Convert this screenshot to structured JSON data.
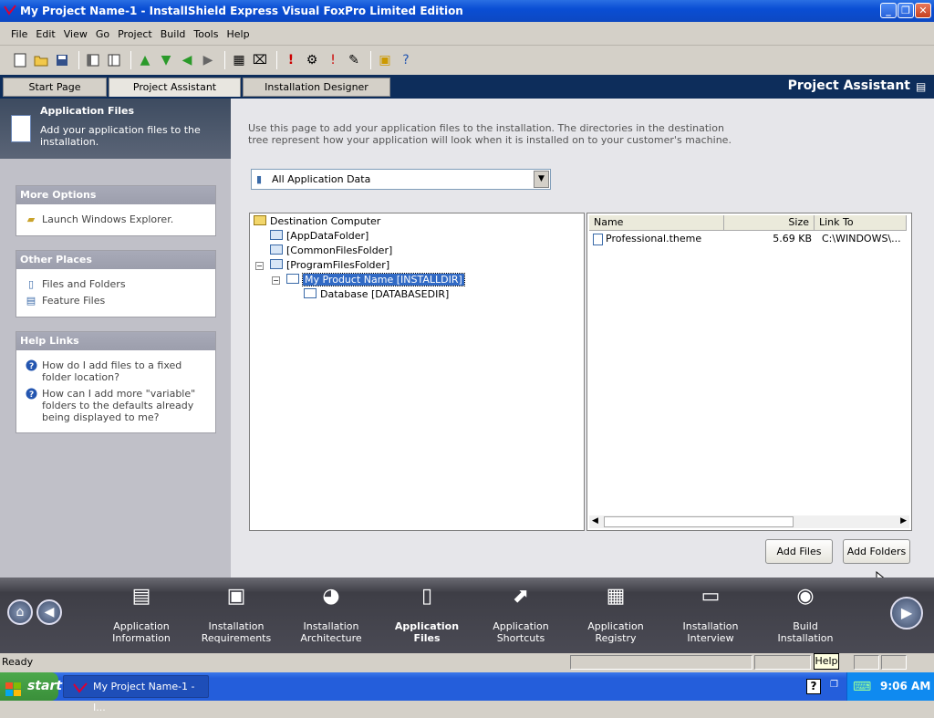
{
  "window": {
    "title": "My Project Name-1 - InstallShield Express Visual FoxPro Limited Edition"
  },
  "menu": [
    "File",
    "Edit",
    "View",
    "Go",
    "Project",
    "Build",
    "Tools",
    "Help"
  ],
  "tabs": {
    "start_page": "Start Page",
    "project_assistant": "Project Assistant",
    "installation_designer": "Installation Designer"
  },
  "header_title": "Project Assistant",
  "left_panel": {
    "heading": "Application Files",
    "description": "Add your application files to the installation.",
    "more_options": {
      "title": "More Options",
      "items": [
        "Launch Windows Explorer."
      ]
    },
    "other_places": {
      "title": "Other Places",
      "items": [
        "Files and Folders",
        "Feature Files"
      ]
    },
    "help_links": {
      "title": "Help Links",
      "items": [
        "How do I add files to a fixed folder location?",
        "How can I add more \"variable\" folders to the defaults already being displayed to me?"
      ]
    }
  },
  "main": {
    "description": "Use this page to add your application files to the installation. The directories in the destination tree represent how your application will look when it is installed on to your customer's machine.",
    "combo_value": "All Application Data",
    "tree": {
      "root": "Destination Computer",
      "nodes": [
        "[AppDataFolder]",
        "[CommonFilesFolder]",
        "[ProgramFilesFolder]",
        "My Product Name [INSTALLDIR]",
        "Database [DATABASEDIR]"
      ]
    },
    "list": {
      "columns": [
        "Name",
        "Size",
        "Link To"
      ],
      "rows": [
        {
          "name": "Professional.theme",
          "size": "5.69 KB",
          "link": "C:\\WINDOWS\\..."
        }
      ]
    },
    "buttons": {
      "add_files": "Add Files",
      "add_folders": "Add Folders"
    }
  },
  "nav": [
    {
      "line1": "Application",
      "line2": "Information"
    },
    {
      "line1": "Installation",
      "line2": "Requirements"
    },
    {
      "line1": "Installation",
      "line2": "Architecture"
    },
    {
      "line1": "Application",
      "line2": "Files"
    },
    {
      "line1": "Application",
      "line2": "Shortcuts"
    },
    {
      "line1": "Application",
      "line2": "Registry"
    },
    {
      "line1": "Installation",
      "line2": "Interview"
    },
    {
      "line1": "Build",
      "line2": "Installation"
    }
  ],
  "status": {
    "text": "Ready",
    "tooltip": "Help"
  },
  "taskbar": {
    "start": "start",
    "task": "My Project Name-1 - I...",
    "clock": "9:06 AM"
  }
}
